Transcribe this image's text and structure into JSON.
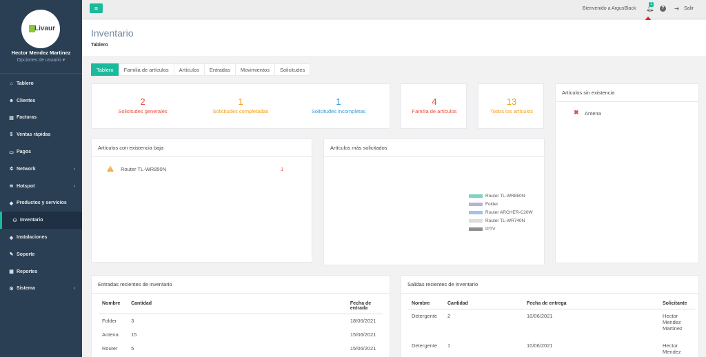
{
  "sidebar": {
    "logo_text": "Livaur",
    "user_name": "Hector Mendez Martinez",
    "user_options": "Opciones de usuario ▾",
    "items": [
      {
        "icon": "⌂",
        "label": "Tablero",
        "name": "tablero",
        "chevron": false
      },
      {
        "icon": "☻",
        "label": "Clientes",
        "name": "clientes",
        "chevron": false
      },
      {
        "icon": "▤",
        "label": "Facturas",
        "name": "facturas",
        "chevron": false
      },
      {
        "icon": "$",
        "label": "Ventas rápidas",
        "name": "ventas-rapidas",
        "chevron": false
      },
      {
        "icon": "▭",
        "label": "Pagos",
        "name": "pagos",
        "chevron": false
      },
      {
        "icon": "✲",
        "label": "Network",
        "name": "network",
        "chevron": true
      },
      {
        "icon": "≋",
        "label": "Hotspot",
        "name": "hotspot",
        "chevron": true
      },
      {
        "icon": "◆",
        "label": "Productos y servicios",
        "name": "productos",
        "chevron": false
      },
      {
        "icon": "⚇",
        "label": "Inventario",
        "name": "inventario",
        "chevron": false,
        "active": true
      },
      {
        "icon": "◈",
        "label": "Instalaciones",
        "name": "instalaciones",
        "chevron": false
      },
      {
        "icon": "✎",
        "label": "Soporte",
        "name": "soporte",
        "chevron": false
      },
      {
        "icon": "▦",
        "label": "Reportes",
        "name": "reportes",
        "chevron": false
      },
      {
        "icon": "⚙",
        "label": "Sistema",
        "name": "sistema",
        "chevron": true
      }
    ]
  },
  "topbar": {
    "menu_icon": "≡",
    "welcome": "Bienvenido a ArgusBlack",
    "notification_count": "1",
    "help": "?",
    "logout": "Salir"
  },
  "page": {
    "title": "Inventario",
    "subtitle": "Tablero"
  },
  "tabs": [
    "Tablero",
    "Familia de artículos",
    "Artículos",
    "Entradas",
    "Movimientos",
    "Solicitudes"
  ],
  "stats": {
    "generales": {
      "num": "2",
      "label": "Solicitudes generales"
    },
    "completadas": {
      "num": "1",
      "label": "Solicitudes completadas"
    },
    "incompletas": {
      "num": "1",
      "label": "Solicitudes incompletas"
    },
    "familia": {
      "num": "4",
      "label": "Familia de artículos"
    },
    "todos": {
      "num": "13",
      "label": "Todos los artículos"
    }
  },
  "sin_existencia": {
    "title": "Artículos sin existencia",
    "items": [
      "Antena"
    ]
  },
  "existencia_baja": {
    "title": "Artículos con existencia baja",
    "item": "Router TL-WR850N",
    "qty": "1"
  },
  "mas_solicitados": {
    "title": "Artículos más solicitados",
    "legend": [
      {
        "name": "Router TL-WR850N",
        "color": "#7fd3c0"
      },
      {
        "name": "Folder",
        "color": "#b3b3d9"
      },
      {
        "name": "Router ARCHER-C20W",
        "color": "#9fc5e8"
      },
      {
        "name": "Router TL-WR740N",
        "color": "#dcdcdc"
      },
      {
        "name": "IPTV",
        "color": "#8f8f8f"
      }
    ]
  },
  "entradas": {
    "title": "Entradas recientes de inventario",
    "headers": [
      "Nombre",
      "Cantidad",
      "Fecha de entrada"
    ],
    "rows": [
      [
        "Folder",
        "3",
        "18/06/2021"
      ],
      [
        "Antena",
        "15",
        "15/06/2021"
      ],
      [
        "Router",
        "5",
        "15/06/2021"
      ]
    ]
  },
  "salidas": {
    "title": "Salidas recientes de inventario",
    "headers": [
      "Nombre",
      "Cantidad",
      "Fecha de entrega",
      "Solicitante"
    ],
    "rows": [
      [
        "Detergente",
        "2",
        "10/06/2021",
        "Hector Mendez Martinez"
      ],
      [
        "Detergente",
        "1",
        "10/06/2021",
        "Hector Mendez"
      ]
    ]
  }
}
